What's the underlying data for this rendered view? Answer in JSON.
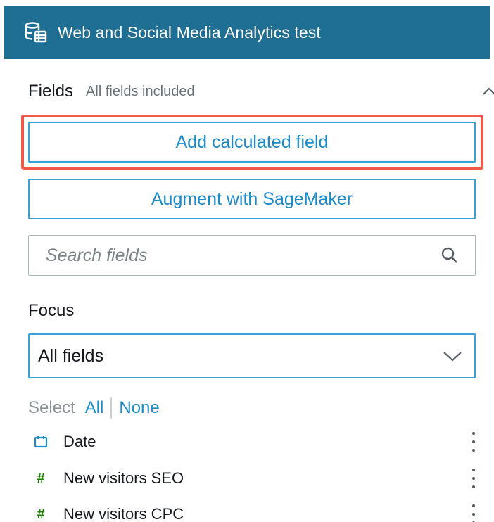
{
  "header": {
    "dataset_title": "Web and Social Media Analytics test"
  },
  "fields": {
    "label": "Fields",
    "status": "All fields included"
  },
  "buttons": {
    "add_calculated": "Add calculated field",
    "augment": "Augment with SageMaker"
  },
  "search": {
    "placeholder": "Search fields",
    "value": ""
  },
  "focus": {
    "label": "Focus",
    "selected": "All fields"
  },
  "selection": {
    "label": "Select",
    "all": "All",
    "none": "None"
  },
  "field_list": [
    {
      "name": "Date",
      "type": "date"
    },
    {
      "name": "New visitors SEO",
      "type": "number",
      "type_glyph": "#"
    },
    {
      "name": "New visitors CPC",
      "type": "number",
      "type_glyph": "#"
    }
  ],
  "colors": {
    "header_bg": "#1f6e93",
    "accent": "#1b8ac8",
    "highlight": "#f2594b",
    "number_type": "#1d8102"
  }
}
